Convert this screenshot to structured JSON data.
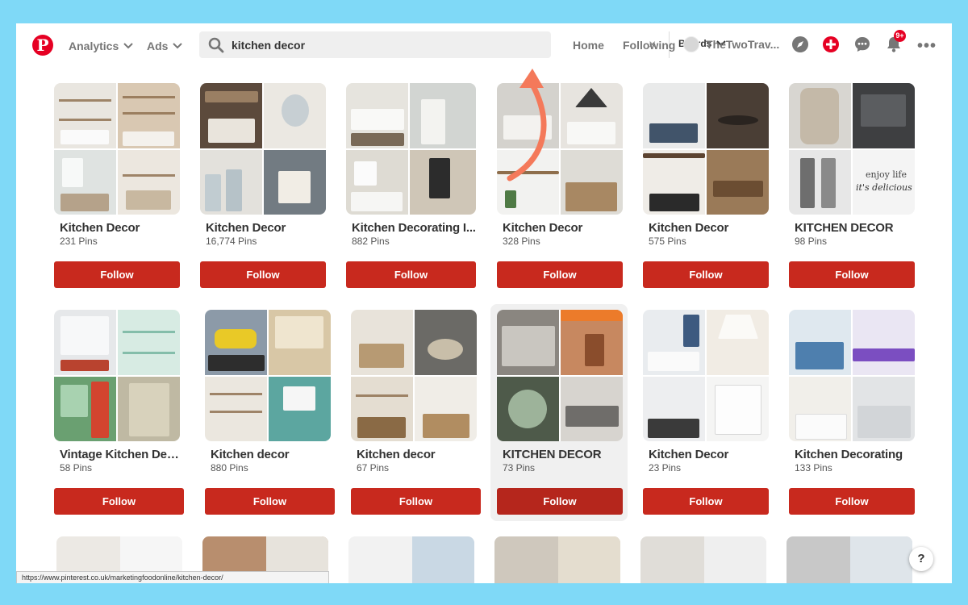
{
  "header": {
    "nav": [
      {
        "label": "Analytics"
      },
      {
        "label": "Ads"
      }
    ],
    "search": {
      "value": "kitchen decor",
      "clear": "×",
      "scope": "Boards"
    },
    "links": {
      "home": "Home",
      "following": "Following"
    },
    "user": {
      "name": "TheTwoTrav..."
    },
    "notifications_badge": "9+",
    "more": "•••"
  },
  "colors": {
    "brand": "#e60023",
    "follow": "#c8291e",
    "arrow": "#f4795a",
    "background": "#7fd9f7"
  },
  "boards": [
    {
      "title": "Kitchen Decor",
      "pins": "231 Pins",
      "follow": "Follow"
    },
    {
      "title": "Kitchen Decor",
      "pins": "16,774 Pins",
      "follow": "Follow"
    },
    {
      "title": "Kitchen Decorating I...",
      "pins": "882 Pins",
      "follow": "Follow"
    },
    {
      "title": "Kitchen Decor",
      "pins": "328 Pins",
      "follow": "Follow"
    },
    {
      "title": "Kitchen Decor",
      "pins": "575 Pins",
      "follow": "Follow"
    },
    {
      "title": "KITCHEN DECOR",
      "pins": "98 Pins",
      "follow": "Follow",
      "overlay": [
        "enjoy life",
        "it's delicious"
      ]
    },
    {
      "title": "Vintage Kitchen Dec...",
      "pins": "58 Pins",
      "follow": "Follow"
    },
    {
      "title": "Kitchen decor",
      "pins": "880 Pins",
      "follow": "Follow"
    },
    {
      "title": "Kitchen decor",
      "pins": "67 Pins",
      "follow": "Follow"
    },
    {
      "title": "KITCHEN DECOR",
      "pins": "73 Pins",
      "follow": "Follow"
    },
    {
      "title": "Kitchen Decor",
      "pins": "23 Pins",
      "follow": "Follow"
    },
    {
      "title": "Kitchen Decorating",
      "pins": "133 Pins",
      "follow": "Follow"
    }
  ],
  "help_button": "?",
  "status_url": "https://www.pinterest.co.uk/marketingfoodonline/kitchen-decor/"
}
